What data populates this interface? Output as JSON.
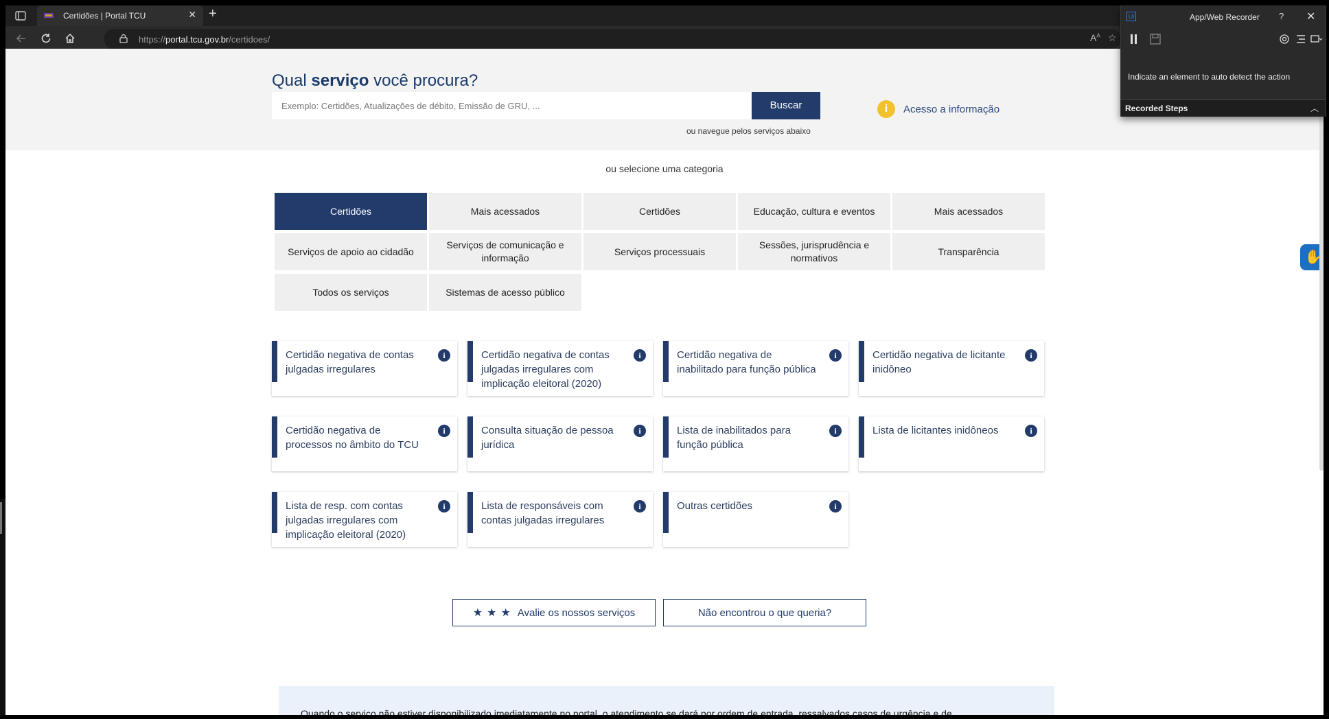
{
  "browser": {
    "tab_title": "Certidões | Portal TCU",
    "tab_close": "✕",
    "new_tab": "+",
    "url_prefix": "https://",
    "url_domain": "portal.tcu.gov.br",
    "url_path": "/certidoes/"
  },
  "recorder": {
    "logo": "Ui",
    "title": "App/Web Recorder",
    "help": "?",
    "close": "✕",
    "message": "Indicate an element to auto detect the action",
    "steps_label": "Recorded Steps",
    "steps_chevron": "︿"
  },
  "search": {
    "title_pre": "Qual ",
    "title_bold": "serviço",
    "title_post": " você procura?",
    "placeholder": "Exemplo: Certidões, Atualizações de débito, Emissão de GRU, ...",
    "button": "Buscar",
    "hint": "ou navegue pelos serviços abaixo",
    "access_icon": "i",
    "access_link": "Acesso a informação"
  },
  "categories": {
    "label": "ou selecione uma categoria",
    "items": [
      "Certidões",
      "Mais acessados",
      "Certidões",
      "Educação, cultura e eventos",
      "Mais acessados",
      "Serviços de apoio ao cidadão",
      "Serviços de comunicação e informação",
      "Serviços processuais",
      "Sessões, jurisprudência e normativos",
      "Transparência",
      "Todos os serviços",
      "Sistemas de acesso público"
    ]
  },
  "services": [
    "Certidão negativa de contas julgadas irregulares",
    "Certidão negativa de contas julgadas irregulares com implicação eleitoral (2020)",
    "Certidão negativa de inabilitado para função pública",
    "Certidão negativa de licitante inidôneo",
    "Certidão negativa de processos no âmbito do TCU",
    "Consulta situação de pessoa jurídica",
    "Lista de inabilitados para função pública",
    "Lista de licitantes inidôneos",
    "Lista de resp. com contas julgadas irregulares com implicação eleitoral (2020)",
    "Lista de responsáveis com contas julgadas irregulares",
    "Outras certidões"
  ],
  "info_icon": "i",
  "actions": {
    "rate_stars": "★★★",
    "rate_label": "Avalie os nossos serviços",
    "not_found": "Não encontrou o que queria?"
  },
  "notice": "Quando o serviço não estiver disponibilizado imediatamente no portal, o atendimento se dará por ordem de entrada, ressalvados casos de urgência e de",
  "colors": {
    "primary": "#223b6b",
    "accent_yellow": "#f2c12e",
    "band_bg": "#f3f3f3"
  }
}
